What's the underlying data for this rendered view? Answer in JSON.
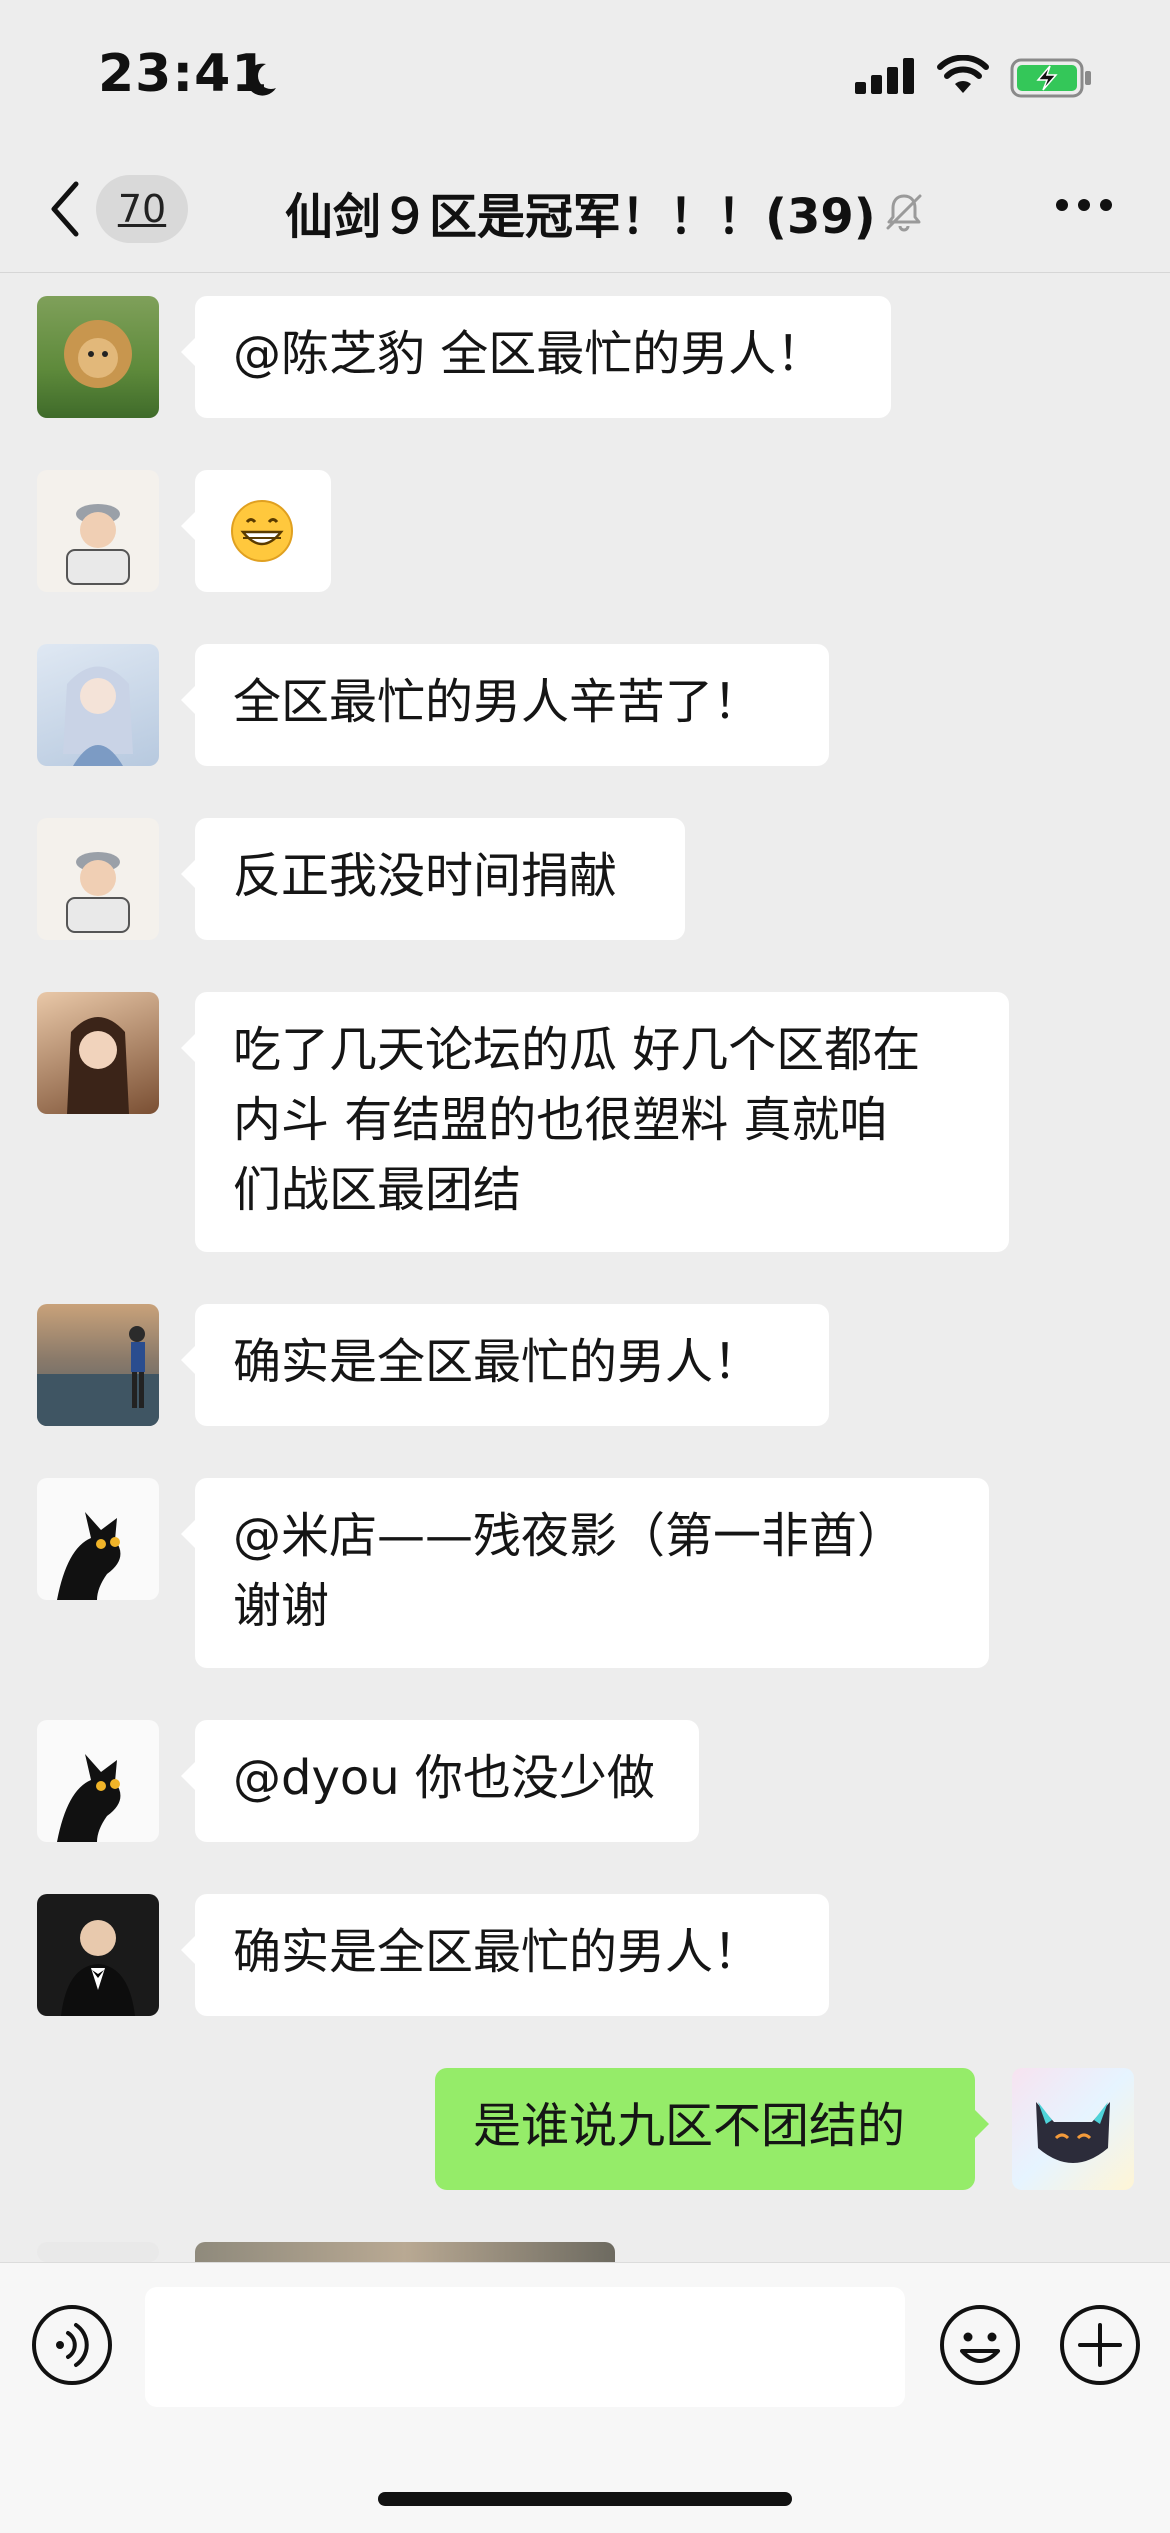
{
  "status_bar": {
    "time": "23:41",
    "icons": [
      "moon-icon",
      "signal-icon",
      "wifi-icon",
      "battery-charging-icon"
    ]
  },
  "nav": {
    "unread_count": "70",
    "title": "仙剑９区是冠军！！！(39)",
    "icons": [
      "back-icon",
      "muted-bell-icon",
      "more-icon"
    ]
  },
  "messages": [
    {
      "side": "left",
      "avatar": "lion-avatar",
      "text": "@陈芝豹 全区最忙的男人！"
    },
    {
      "side": "left",
      "avatar": "baby-avatar",
      "text": "😁"
    },
    {
      "side": "left",
      "avatar": "anime-girl-avatar",
      "text": "全区最忙的男人辛苦了！"
    },
    {
      "side": "left",
      "avatar": "baby-avatar",
      "text": "反正我没时间捐献"
    },
    {
      "side": "left",
      "avatar": "woman-avatar",
      "lines": [
        "吃了几天论坛的瓜 好几个区都在",
        "内斗 有结盟的也很塑料 真就咱",
        "们战区最团结"
      ]
    },
    {
      "side": "left",
      "avatar": "runner-avatar",
      "text": "确实是全区最忙的男人！"
    },
    {
      "side": "left",
      "avatar": "black-cat-avatar",
      "lines": [
        "@米店——残夜影（第一非酋）",
        "谢谢"
      ]
    },
    {
      "side": "left",
      "avatar": "black-cat-avatar",
      "text": "@dyou 你也没少做"
    },
    {
      "side": "left",
      "avatar": "suit-man-avatar",
      "text": "确实是全区最忙的男人！"
    },
    {
      "side": "right",
      "avatar": "cat-cartoon-avatar",
      "text": "是谁说九区不团结的"
    }
  ],
  "input_bar": {
    "icons": [
      "voice-icon",
      "emoji-icon",
      "plus-icon"
    ]
  },
  "colors": {
    "background": "#EDEDED",
    "bubble_self": "#95EC69",
    "bubble_other": "#FFFFFF"
  }
}
